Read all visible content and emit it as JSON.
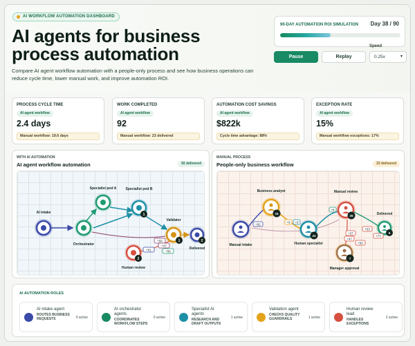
{
  "header": {
    "badge": "AI WORKFLOW AUTOMATION DASHBOARD",
    "title": "AI agents for business process automation",
    "subtitle": "Compare AI agent workflow automation with a people-only process and see how business operations can reduce cycle time, lower manual work, and improve automation ROI."
  },
  "simulation": {
    "label": "90-DAY AUTOMATION ROI SIMULATION",
    "day_text": "Day 38 / 90",
    "progress": 0.42,
    "pause_label": "Pause",
    "replay_label": "Replay",
    "speed_label": "Speed",
    "speed_value": "0.25x"
  },
  "metrics": [
    {
      "label": "PROCESS CYCLE TIME",
      "pill": "AI agent workflow",
      "value": "2.4 days",
      "note": "Manual workflow: 19.6 days"
    },
    {
      "label": "WORK COMPLETED",
      "pill": "AI agent workflow",
      "value": "92",
      "note": "Manual workflow: 23 delivered"
    },
    {
      "label": "AUTOMATION COST SAVINGS",
      "pill": "AI agent workflow",
      "value": "$822k",
      "note": "Cycle time advantage: 88%"
    },
    {
      "label": "EXCEPTION RATE",
      "pill": "AI agent workflow",
      "value": "15%",
      "note": "Manual workflow exceptions: 17%"
    }
  ],
  "ai_panel": {
    "kicker": "WITH AI AUTOMATION",
    "title": "AI agent workflow automation",
    "badge": "92 delivered",
    "nodes": {
      "intake": "AI intake",
      "orchestrator": "Orchestrator",
      "spec_a": "Specialist pod A",
      "spec_b": "Specialist pod B",
      "validator": "Validator",
      "delivered": "Delivered",
      "human_review": "Human review"
    },
    "counts": {
      "spec_b": "1",
      "validator": "1",
      "delivered": "2",
      "human_review": "2"
    },
    "chips": [
      "+56",
      "+47",
      "+61",
      "+56"
    ]
  },
  "manual_panel": {
    "kicker": "MANUAL PROCESS",
    "title": "People-only business workflow",
    "badge": "23 delivered",
    "nodes": {
      "intake": "Manual intake",
      "analyst": "Business analyst",
      "specialist": "Human specialist",
      "review": "Manual review",
      "delivered": "Delivered",
      "approval": "Manager approval"
    },
    "counts": {
      "analyst": "15",
      "specialist": "24",
      "review": "25",
      "delivered": "6",
      "approval": "7"
    },
    "chips": [
      "+92",
      "+9",
      "+9",
      "+8",
      "+53",
      "+37",
      "+50",
      "+47",
      "+77"
    ]
  },
  "roles": {
    "title": "AI AUTOMATION ROLES",
    "items": [
      {
        "name": "AI intake agent",
        "desc": "ROUTES BUSINESS REQUESTS",
        "count": "0 active",
        "color": "#3b4aa8"
      },
      {
        "name": "AI orchestrator agents",
        "desc": "COORDINATES WORKFLOW STEPS",
        "count": "0 active",
        "color": "#178a60"
      },
      {
        "name": "Specialist AI agents",
        "desc": "RESEARCH AND DRAFT OUTPUTS",
        "count": "1 active",
        "color": "#1e8fa7"
      },
      {
        "name": "Validation agent",
        "desc": "CHECKS QUALITY GUARDRAILS",
        "count": "1 active",
        "color": "#e3a31a"
      },
      {
        "name": "Human review lead",
        "desc": "HANDLES EXCEPTIONS",
        "count": "2 active",
        "color": "#d65040"
      }
    ]
  }
}
